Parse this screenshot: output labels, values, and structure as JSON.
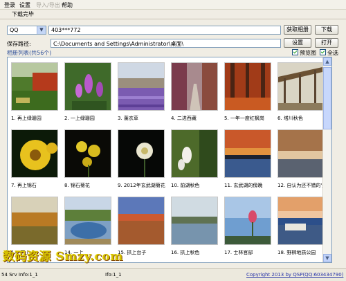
{
  "menu": [
    "登录",
    "设置",
    "导入/导出",
    "帮助"
  ],
  "status_message": "下载完毕",
  "source_select": {
    "value": "QQ"
  },
  "account_input": {
    "value": "403***772"
  },
  "buttons": {
    "fetch_album": "获取相册",
    "download": "下载",
    "settings": "设置",
    "open": "打开"
  },
  "save_path": {
    "label": "保存路径:",
    "value": "C:\\Documents and Settings\\Administrator\\桌面\\"
  },
  "album_list_label": "相册列表(共56个)",
  "checkboxes": {
    "preview": "预览图",
    "select_all": "全选"
  },
  "albums": [
    {
      "caption": "1. 再上绿珊园"
    },
    {
      "caption": "2. 一上绿珊园"
    },
    {
      "caption": "3. 薰衣草"
    },
    {
      "caption": "4. 二进西藏"
    },
    {
      "caption": "5. 一年一度红枫岗"
    },
    {
      "caption": "6. 塔川秋色"
    },
    {
      "caption": "7. 再上锦石"
    },
    {
      "caption": "8. 锦石菊花"
    },
    {
      "caption": "9. 2012年玄武湖菊花"
    },
    {
      "caption": "10. 前湖秋色"
    },
    {
      "caption": "11. 玄武湖的傍晚"
    },
    {
      "caption": "12. 自认为还不错的'果"
    },
    {
      "caption": "13. 再上"
    },
    {
      "caption": "14. 一上"
    },
    {
      "caption": "15. 拱上台子"
    },
    {
      "caption": "16. 拱上秋色"
    },
    {
      "caption": "17. 士林官邸"
    },
    {
      "caption": "18. 野柳地质公园"
    }
  ],
  "statusbar": {
    "left": "54   Srv Info:1_1",
    "mid": "Ifo:1_1",
    "copyright": "Copyright 2013 by QSP(QQ:603434790)"
  },
  "watermark": "数码资源 Smzy.com",
  "icons": {
    "dropdown": "chevron-down-icon",
    "scroll_up": "arrow-up-icon",
    "scroll_down": "arrow-down-icon"
  }
}
